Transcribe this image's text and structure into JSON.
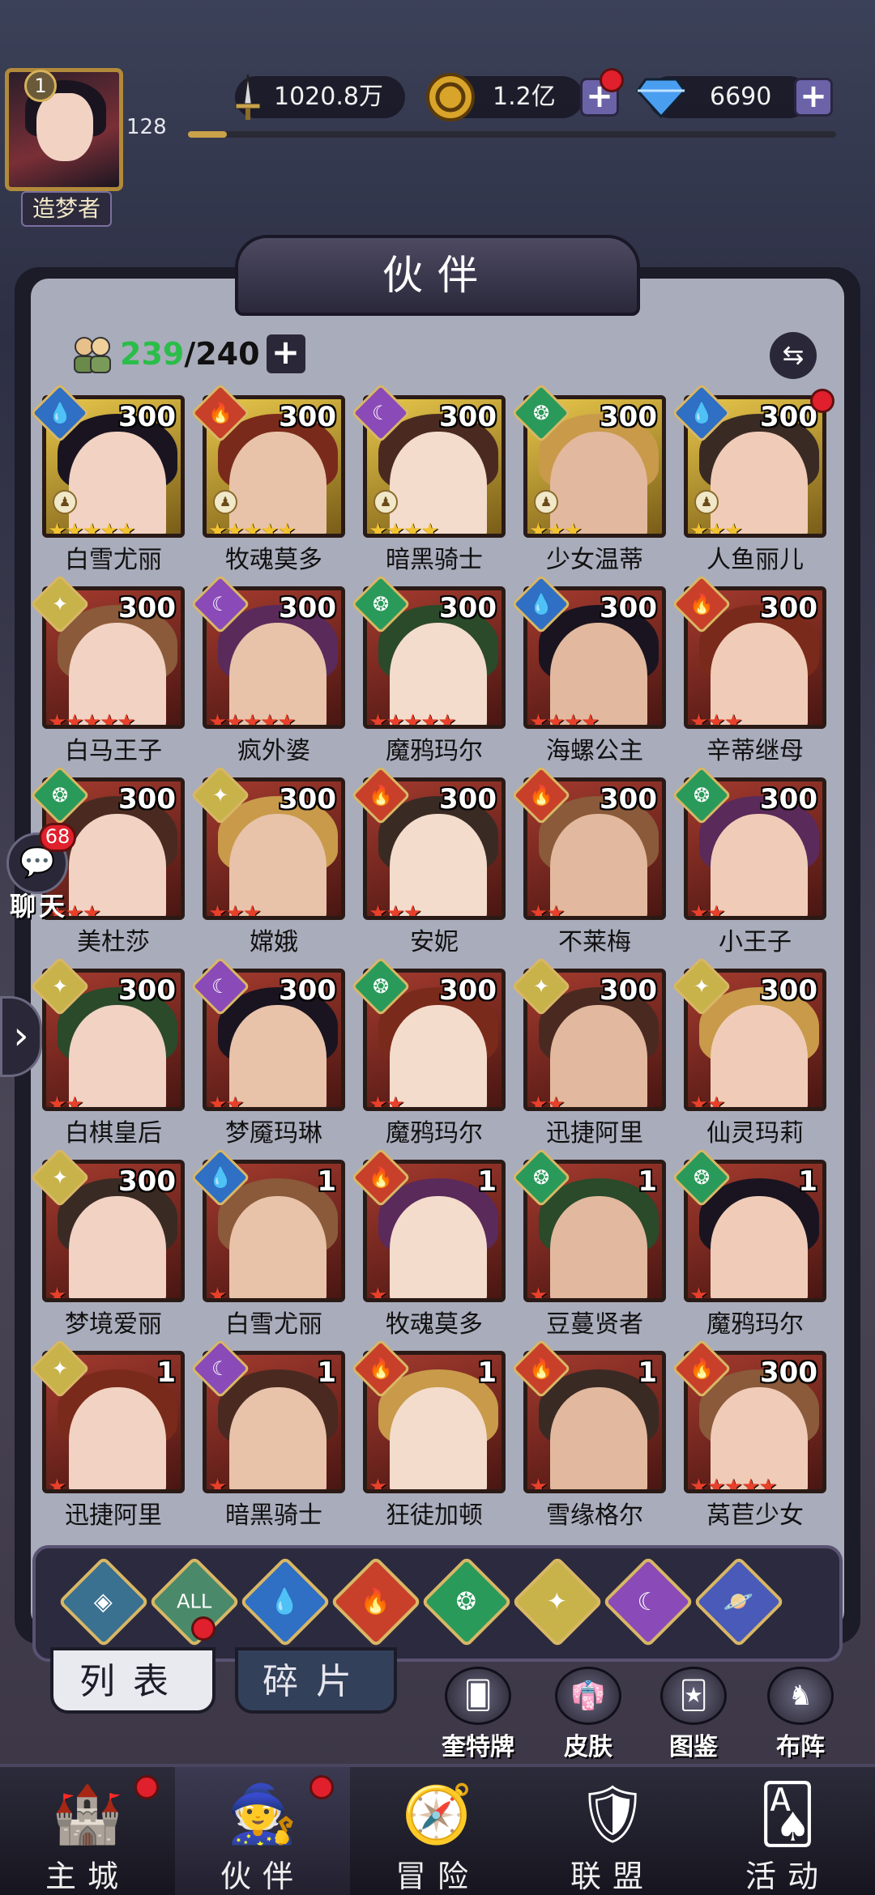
{
  "player": {
    "level": "1",
    "exp_value": "128",
    "title": "造梦者",
    "exp_progress": 0.06
  },
  "resources": {
    "power": "1020.8万",
    "gold": "1.2亿",
    "diamond": "6690"
  },
  "panel": {
    "title": "伙伴",
    "count_current": "239",
    "count_total": "/240"
  },
  "chat": {
    "unread": "68",
    "label": "聊天"
  },
  "characters": [
    {
      "name": "白雪尤丽",
      "level": "300",
      "stars": 5,
      "star_color": "gold",
      "frame": "gold",
      "element": "water",
      "rank": true,
      "dot": false
    },
    {
      "name": "牧魂莫多",
      "level": "300",
      "stars": 5,
      "star_color": "gold",
      "frame": "gold",
      "element": "fire",
      "rank": true,
      "dot": false
    },
    {
      "name": "暗黑骑士",
      "level": "300",
      "stars": 4,
      "star_color": "gold",
      "frame": "gold",
      "element": "dark",
      "rank": true,
      "dot": false
    },
    {
      "name": "少女温蒂",
      "level": "300",
      "stars": 3,
      "star_color": "gold",
      "frame": "gold",
      "element": "wind",
      "rank": true,
      "dot": false
    },
    {
      "name": "人鱼丽儿",
      "level": "300",
      "stars": 3,
      "star_color": "gold",
      "frame": "gold",
      "element": "water",
      "rank": true,
      "dot": true
    },
    {
      "name": "白马王子",
      "level": "300",
      "stars": 5,
      "star_color": "red",
      "frame": "red",
      "element": "light",
      "rank": false,
      "dot": false
    },
    {
      "name": "疯外婆",
      "level": "300",
      "stars": 5,
      "star_color": "red",
      "frame": "red",
      "element": "dark",
      "rank": false,
      "dot": false
    },
    {
      "name": "魔鸦玛尔",
      "level": "300",
      "stars": 5,
      "star_color": "red",
      "frame": "red",
      "element": "wind",
      "rank": false,
      "dot": false
    },
    {
      "name": "海螺公主",
      "level": "300",
      "stars": 4,
      "star_color": "red",
      "frame": "red",
      "element": "water",
      "rank": false,
      "dot": false
    },
    {
      "name": "辛蒂继母",
      "level": "300",
      "stars": 3,
      "star_color": "red",
      "frame": "red",
      "element": "fire",
      "rank": false,
      "dot": false
    },
    {
      "name": "美杜莎",
      "level": "300",
      "stars": 3,
      "star_color": "red",
      "frame": "red",
      "element": "wind",
      "rank": false,
      "dot": false
    },
    {
      "name": "嫦娥",
      "level": "300",
      "stars": 3,
      "star_color": "red",
      "frame": "red",
      "element": "light",
      "rank": false,
      "dot": false
    },
    {
      "name": "安妮",
      "level": "300",
      "stars": 3,
      "star_color": "red",
      "frame": "red",
      "element": "fire",
      "rank": false,
      "dot": false
    },
    {
      "name": "不莱梅",
      "level": "300",
      "stars": 2,
      "star_color": "red",
      "frame": "red",
      "element": "fire",
      "rank": false,
      "dot": false
    },
    {
      "name": "小王子",
      "level": "300",
      "stars": 2,
      "star_color": "red",
      "frame": "red",
      "element": "wind",
      "rank": false,
      "dot": false
    },
    {
      "name": "白棋皇后",
      "level": "300",
      "stars": 2,
      "star_color": "red",
      "frame": "red",
      "element": "light",
      "rank": false,
      "dot": false
    },
    {
      "name": "梦魇玛琳",
      "level": "300",
      "stars": 2,
      "star_color": "red",
      "frame": "red",
      "element": "dark",
      "rank": false,
      "dot": false
    },
    {
      "name": "魔鸦玛尔",
      "level": "300",
      "stars": 2,
      "star_color": "red",
      "frame": "red",
      "element": "wind",
      "rank": false,
      "dot": false
    },
    {
      "name": "迅捷阿里",
      "level": "300",
      "stars": 2,
      "star_color": "red",
      "frame": "red",
      "element": "light",
      "rank": false,
      "dot": false
    },
    {
      "name": "仙灵玛莉",
      "level": "300",
      "stars": 2,
      "star_color": "red",
      "frame": "red",
      "element": "light",
      "rank": false,
      "dot": false
    },
    {
      "name": "梦境爱丽",
      "level": "300",
      "stars": 1,
      "star_color": "red",
      "frame": "red",
      "element": "light",
      "rank": false,
      "dot": false
    },
    {
      "name": "白雪尤丽",
      "level": "1",
      "stars": 1,
      "star_color": "red",
      "frame": "red",
      "element": "water",
      "rank": false,
      "dot": false
    },
    {
      "name": "牧魂莫多",
      "level": "1",
      "stars": 1,
      "star_color": "red",
      "frame": "red",
      "element": "fire",
      "rank": false,
      "dot": false
    },
    {
      "name": "豆蔓贤者",
      "level": "1",
      "stars": 1,
      "star_color": "red",
      "frame": "red",
      "element": "wind",
      "rank": false,
      "dot": false
    },
    {
      "name": "魔鸦玛尔",
      "level": "1",
      "stars": 1,
      "star_color": "red",
      "frame": "red",
      "element": "wind",
      "rank": false,
      "dot": false
    },
    {
      "name": "迅捷阿里",
      "level": "1",
      "stars": 1,
      "star_color": "red",
      "frame": "red",
      "element": "light",
      "rank": false,
      "dot": false
    },
    {
      "name": "暗黑骑士",
      "level": "1",
      "stars": 1,
      "star_color": "red",
      "frame": "red",
      "element": "dark",
      "rank": false,
      "dot": false
    },
    {
      "name": "狂徒加顿",
      "level": "1",
      "stars": 1,
      "star_color": "red",
      "frame": "red",
      "element": "fire",
      "rank": false,
      "dot": false
    },
    {
      "name": "雪缘格尔",
      "level": "1",
      "stars": 1,
      "star_color": "red",
      "frame": "red",
      "element": "fire",
      "rank": false,
      "dot": false
    },
    {
      "name": "莴苣少女",
      "level": "300",
      "stars": 5,
      "star_color": "red",
      "frame": "red",
      "element": "fire",
      "rank": false,
      "dot": false
    }
  ],
  "element_icons": {
    "water": {
      "glyph": "💧",
      "color": "#2f6fc4"
    },
    "fire": {
      "glyph": "🔥",
      "color": "#c8402a"
    },
    "dark": {
      "glyph": "☾",
      "color": "#8a4ab8"
    },
    "wind": {
      "glyph": "❂",
      "color": "#2a9a5a"
    },
    "light": {
      "glyph": "✦",
      "color": "#c8b24a"
    }
  },
  "filters": [
    {
      "id": "diamond",
      "label": "",
      "glyph": "◈",
      "color": "#3a7090"
    },
    {
      "id": "all",
      "label": "ALL",
      "glyph": "",
      "color": "#4a8a6a"
    },
    {
      "id": "water",
      "label": "",
      "glyph": "💧",
      "color": "#2f6fc4"
    },
    {
      "id": "fire",
      "label": "",
      "glyph": "🔥",
      "color": "#c8402a"
    },
    {
      "id": "wind",
      "label": "",
      "glyph": "❂",
      "color": "#2a9a5a"
    },
    {
      "id": "light",
      "label": "",
      "glyph": "✦",
      "color": "#c8b24a"
    },
    {
      "id": "dark",
      "label": "",
      "glyph": "☾",
      "color": "#8a4ab8"
    },
    {
      "id": "planet",
      "label": "",
      "glyph": "🪐",
      "color": "#4a5ab8"
    }
  ],
  "subtabs": {
    "list": "列表",
    "fragments": "碎片"
  },
  "quick_actions": [
    {
      "label": "奎特牌",
      "glyph": "🂠"
    },
    {
      "label": "皮肤",
      "glyph": "👘"
    },
    {
      "label": "图鉴",
      "glyph": "🃏"
    },
    {
      "label": "布阵",
      "glyph": "♞"
    }
  ],
  "nav": [
    {
      "label": "主城",
      "glyph": "🏰",
      "dot": true
    },
    {
      "label": "伙伴",
      "glyph": "🧙",
      "dot": true
    },
    {
      "label": "冒险",
      "glyph": "🧭",
      "dot": false
    },
    {
      "label": "联盟",
      "glyph": "🛡",
      "dot": false
    },
    {
      "label": "活动",
      "glyph": "🂡",
      "dot": false
    }
  ]
}
